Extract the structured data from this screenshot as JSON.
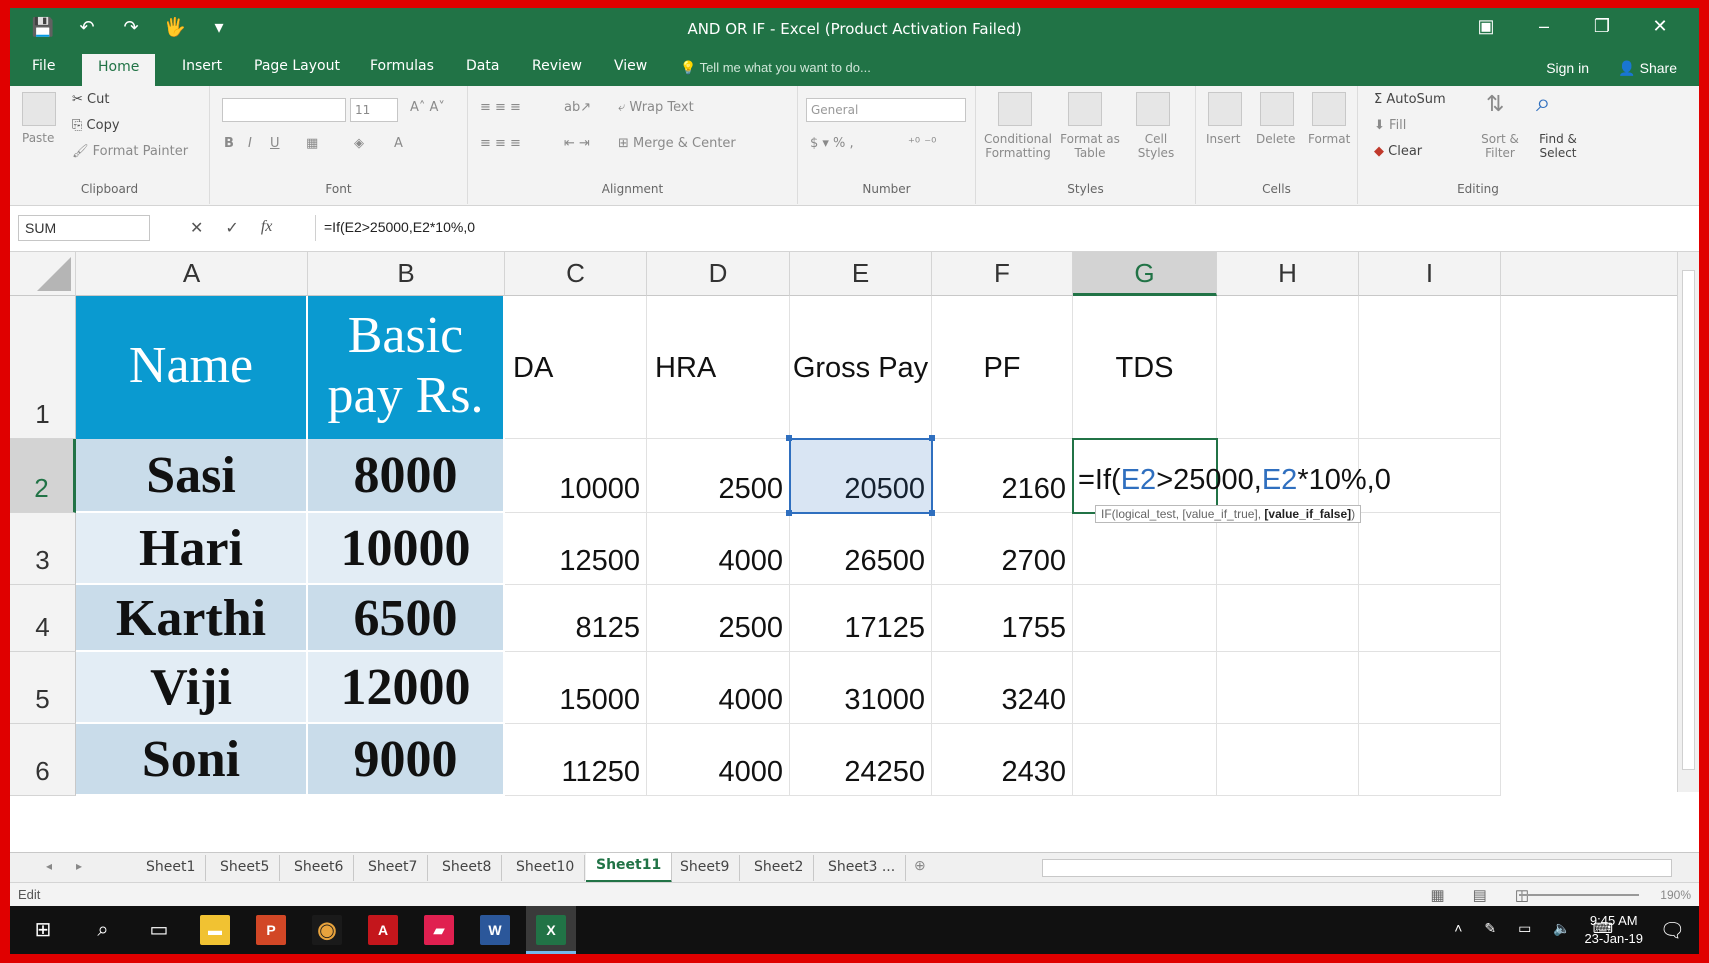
{
  "window": {
    "title": "AND OR IF - Excel (Product Activation Failed)",
    "qat": [
      "💾",
      "↶",
      "↷",
      "🖐",
      "▾"
    ],
    "controls": [
      "▣",
      "–",
      "❐",
      "✕"
    ]
  },
  "tabs": {
    "items": [
      "File",
      "Home",
      "Insert",
      "Page Layout",
      "Formulas",
      "Data",
      "Review",
      "View"
    ],
    "active": "Home",
    "tell_me": "Tell me what you want to do...",
    "sign_in": "Sign in",
    "share": "Share"
  },
  "ribbon": {
    "clipboard": {
      "paste": "Paste",
      "cut": "Cut",
      "copy": "Copy",
      "format_painter": "Format Painter",
      "label": "Clipboard"
    },
    "font": {
      "size": "11",
      "label": "Font"
    },
    "alignment": {
      "wrap_text": "Wrap Text",
      "merge_center": "Merge & Center",
      "label": "Alignment"
    },
    "number": {
      "format": "General",
      "label": "Number"
    },
    "styles": {
      "conditional": "Conditional Formatting",
      "format_table": "Format as Table",
      "cell_styles": "Cell Styles",
      "label": "Styles"
    },
    "cells": {
      "insert": "Insert",
      "delete": "Delete",
      "format": "Format",
      "label": "Cells"
    },
    "editing": {
      "autosum": "AutoSum",
      "fill": "Fill",
      "clear": "Clear",
      "sort": "Sort & Filter",
      "find": "Find & Select",
      "label": "Editing"
    }
  },
  "formula_bar": {
    "name_box": "SUM",
    "formula": "=If(E2>25000,E2*10%,0"
  },
  "columns": [
    "A",
    "B",
    "C",
    "D",
    "E",
    "F",
    "G",
    "H",
    "I"
  ],
  "rows": [
    "1",
    "2",
    "3",
    "4",
    "5",
    "6"
  ],
  "headers": {
    "name": "Name",
    "basic_line1": "Basic",
    "basic_line2": "pay Rs.",
    "da": "DA",
    "hra": "HRA",
    "gross": "Gross Pay",
    "pf": "PF",
    "tds": "TDS"
  },
  "table": [
    {
      "name": "Sasi",
      "basic": "8000",
      "da": "10000",
      "hra": "2500",
      "gross": "20500",
      "pf": "2160"
    },
    {
      "name": "Hari",
      "basic": "10000",
      "da": "12500",
      "hra": "4000",
      "gross": "26500",
      "pf": "2700"
    },
    {
      "name": "Karthi",
      "basic": "6500",
      "da": "8125",
      "hra": "2500",
      "gross": "17125",
      "pf": "1755"
    },
    {
      "name": "Viji",
      "basic": "12000",
      "da": "15000",
      "hra": "4000",
      "gross": "31000",
      "pf": "3240"
    },
    {
      "name": "Soni",
      "basic": "9000",
      "da": "11250",
      "hra": "4000",
      "gross": "24250",
      "pf": "2430"
    }
  ],
  "editing": {
    "prefix": "=If(",
    "ref1": "E2",
    "mid": ">25000,",
    "ref2": "E2",
    "suffix": "*10%,0",
    "tooltip_start": "IF(logical_test, [value_if_true], ",
    "tooltip_bold": "[value_if_false]",
    "tooltip_end": ")"
  },
  "sheets": {
    "items": [
      "Sheet1",
      "Sheet5",
      "Sheet6",
      "Sheet7",
      "Sheet8",
      "Sheet10",
      "Sheet11",
      "Sheet9",
      "Sheet2",
      "Sheet3 ..."
    ],
    "active": "Sheet11"
  },
  "status": {
    "mode": "Edit",
    "zoom": "190%"
  },
  "taskbar": {
    "time": "9:45 AM",
    "date": "23-Jan-19"
  }
}
